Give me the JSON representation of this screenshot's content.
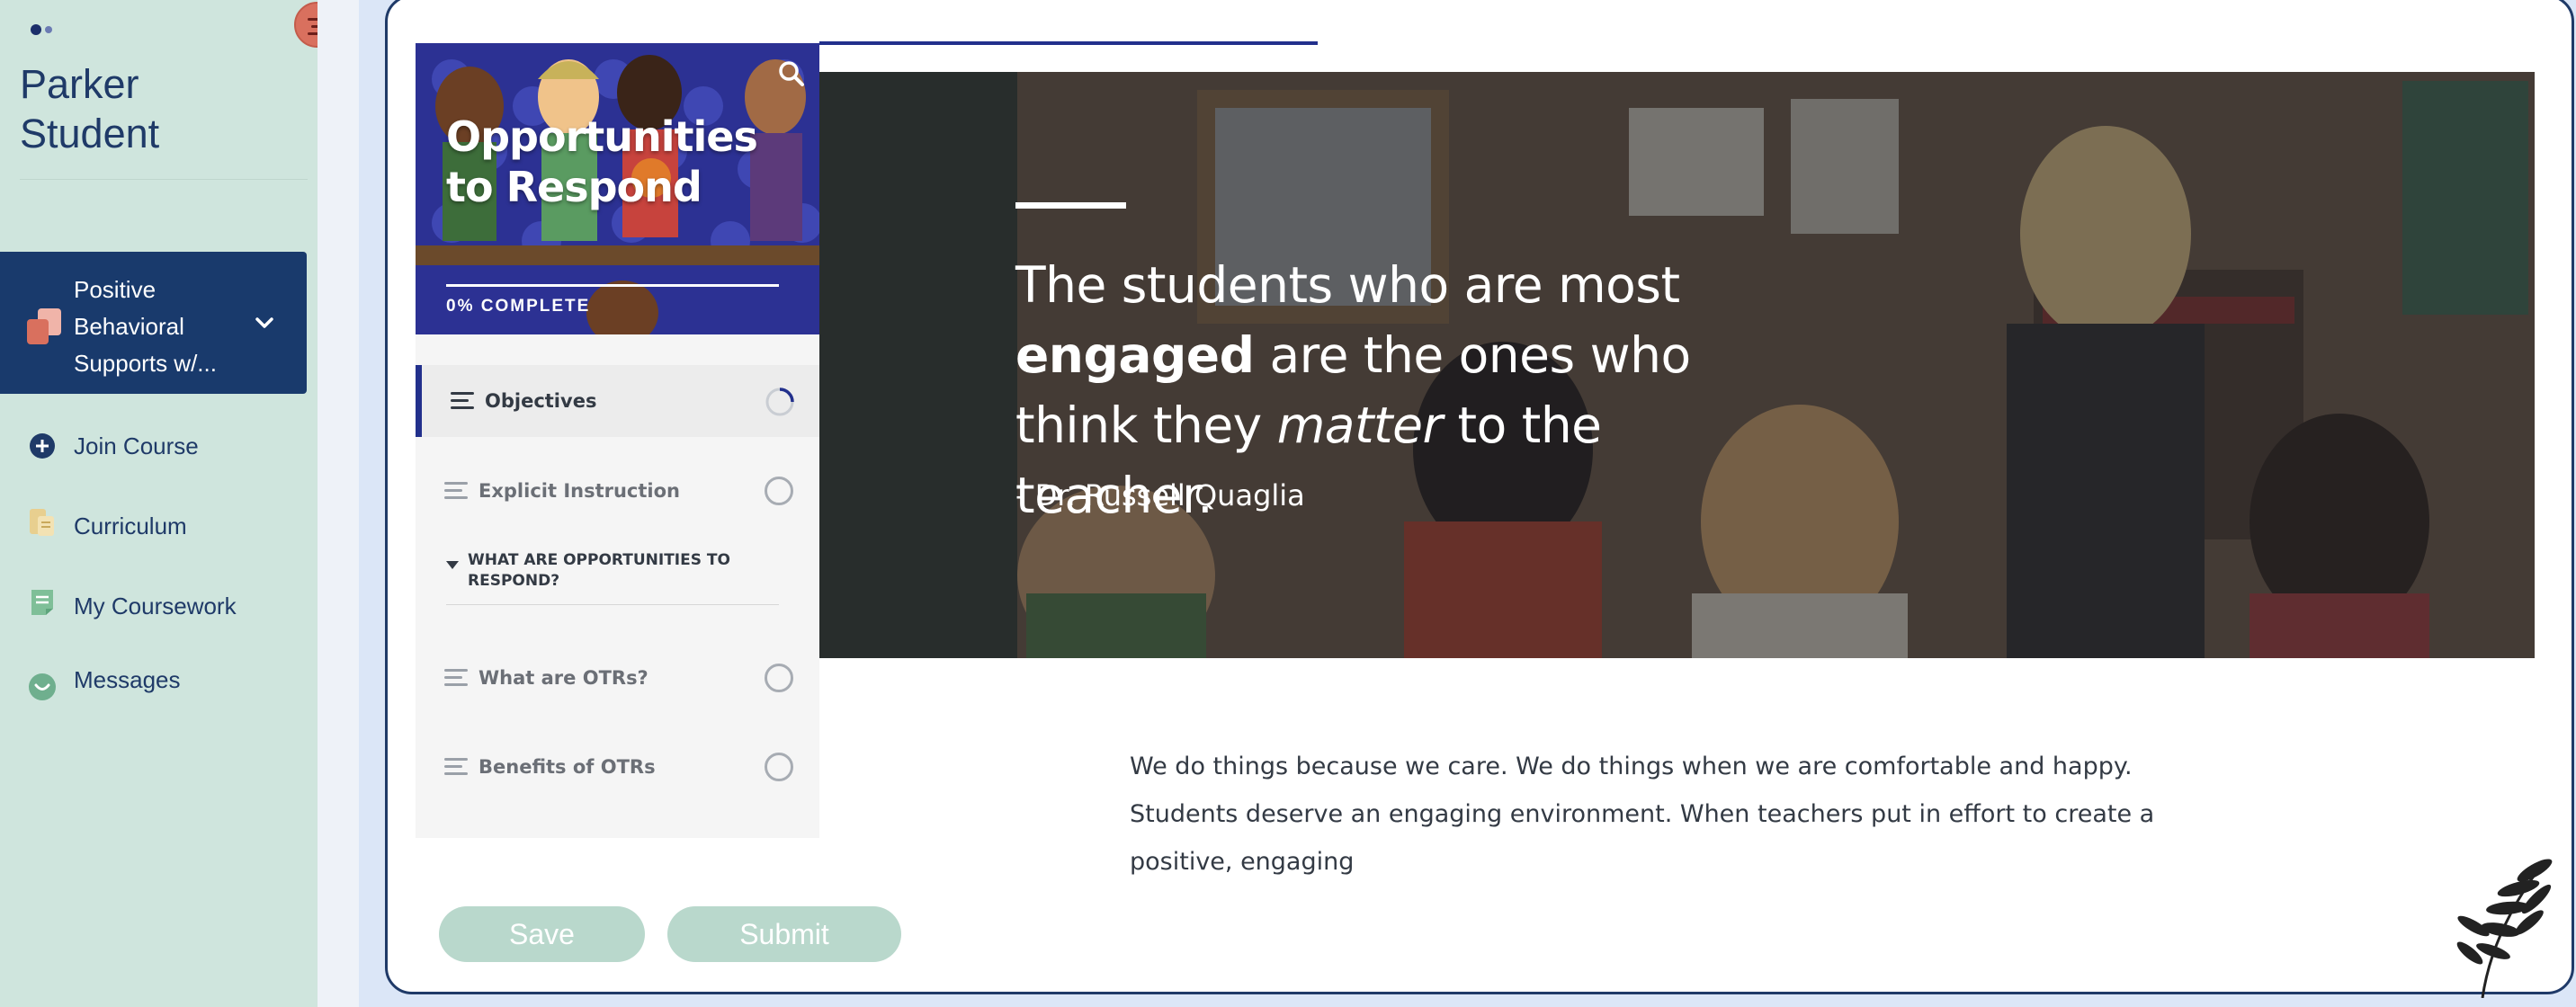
{
  "sidebar": {
    "student_name": "Parker Student",
    "course": {
      "label": "Positive Behavioral Supports w/..."
    },
    "nav": [
      {
        "label": "Join Course",
        "icon": "plus-circle-icon"
      },
      {
        "label": "Curriculum",
        "icon": "curriculum-icon"
      },
      {
        "label": "My Coursework",
        "icon": "coursework-icon"
      },
      {
        "label": "Messages",
        "icon": "messages-icon"
      }
    ]
  },
  "course_panel": {
    "title": "Opportunities to Respond",
    "progress": "0% COMPLETE",
    "lessons": [
      {
        "label": "Objectives",
        "active": true
      },
      {
        "label": "Explicit Instruction",
        "active": false
      }
    ],
    "section": {
      "label": "WHAT ARE OPPORTUNITIES TO RESPOND?"
    },
    "section_lessons": [
      {
        "label": "What are OTRs?"
      },
      {
        "label": "Benefits of OTRs"
      }
    ]
  },
  "hero": {
    "quote_part1": "The students who are most",
    "quote_bold": "engaged",
    "quote_part2": " are the ones who think they ",
    "quote_italic": "matter",
    "quote_part3": " to the teacher.",
    "author": "- Dr. Russell Quaglia"
  },
  "content": {
    "paragraph": "We do things because we care. We do things when we are comfortable and happy. Students deserve an engaging environment. When teachers put in effort to create a positive, engaging"
  },
  "actions": {
    "save_label": "Save",
    "submit_label": "Submit"
  },
  "colors": {
    "sidebar_bg": "#cfe5dd",
    "sidebar_active": "#193a6c",
    "accent_navy": "#22308c",
    "button_bg": "#b9d8cc",
    "menu_button": "#d9705e"
  }
}
